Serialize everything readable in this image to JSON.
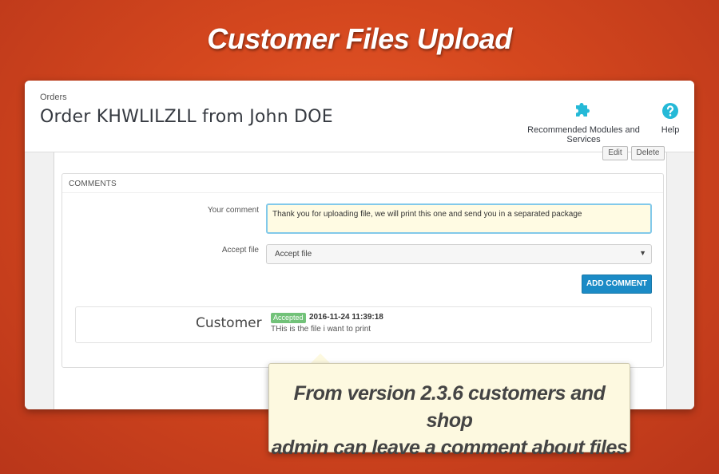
{
  "banner": {
    "title": "Customer Files Upload"
  },
  "header": {
    "breadcrumb": "Orders",
    "title": "Order KHWLILZLL from John DOE",
    "toolbar": [
      {
        "label": "Recommended Modules and Services",
        "icon": "puzzle-icon"
      },
      {
        "label": "Help",
        "icon": "help-icon"
      }
    ]
  },
  "top_buttons": [
    "Edit",
    "Delete"
  ],
  "comments": {
    "heading": "COMMENTS",
    "your_comment_label": "Your comment",
    "your_comment_value": "Thank you for uploading file, we will print this one and send you in a separated package",
    "accept_label": "Accept file",
    "accept_value": "Accept file",
    "add_button": "ADD COMMENT",
    "entries": [
      {
        "author": "Customer",
        "status": "Accepted",
        "date": "2016-11-24 11:39:18",
        "text": "THis is the file i want to print"
      }
    ]
  },
  "callout": {
    "line1": "From version 2.3.6 customers and shop",
    "line2": "admin can leave a comment about files"
  },
  "colors": {
    "accent": "#1b8bc6",
    "icon": "#25b9d7",
    "badge": "#72c279",
    "background": "#d4471e"
  }
}
